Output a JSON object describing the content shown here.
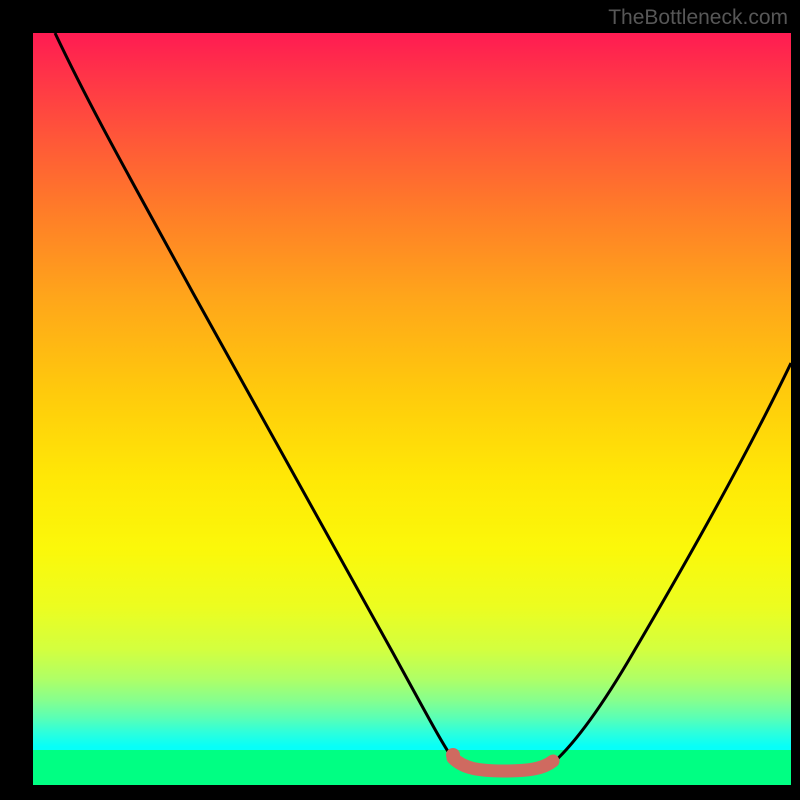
{
  "watermark": "TheBottleneck.com",
  "chart_data": {
    "type": "line",
    "title": "",
    "xlabel": "",
    "ylabel": "",
    "xlim": [
      0,
      100
    ],
    "ylim": [
      0,
      100
    ],
    "background": "vertical rainbow gradient red (top, high) to green (bottom, low)",
    "series": [
      {
        "name": "bottleneck-curve",
        "description": "V-shaped curve; value descends from top-left, reaches near-zero on a short flat segment around x 57-68 (highlighted red), then rises toward top-right",
        "x": [
          3,
          10,
          20,
          30,
          40,
          47,
          52,
          55,
          57,
          60,
          64,
          68,
          72,
          78,
          85,
          92,
          100
        ],
        "y": [
          100,
          91,
          75,
          58,
          40,
          26,
          15,
          8,
          3,
          1,
          1,
          2,
          6,
          15,
          28,
          42,
          57
        ],
        "color": "#000000"
      },
      {
        "name": "optimal-zone",
        "description": "highlighted flat bottom of the V curve (best match region)",
        "x": [
          55,
          57,
          60,
          64,
          68
        ],
        "y": [
          3.5,
          1.5,
          1,
          1,
          2.5
        ],
        "color": "#cf6a60",
        "stroke_width": 13
      }
    ],
    "marker": {
      "x": 55,
      "y": 3.5,
      "color": "#cf6a60",
      "r": 7
    }
  },
  "colors": {
    "frame": "#000000",
    "curve": "#000000",
    "highlight": "#cf6a60",
    "watermark": "#575757"
  }
}
